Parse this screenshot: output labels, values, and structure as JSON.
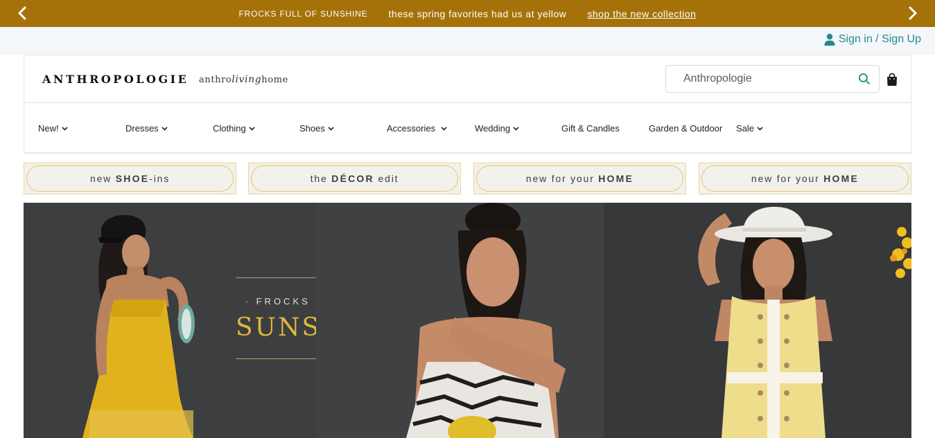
{
  "promo": {
    "eyebrow": "FROCKS FULL OF SUNSHINE",
    "message": "these spring favorites had us at yellow",
    "cta": "shop the new collection",
    "background": "#a5720a"
  },
  "account": {
    "signin_label": "Sign in / Sign Up",
    "accent": "#27898b"
  },
  "header": {
    "logo": "ANTHROPOLOGIE",
    "sub_logo_prefix": "anthro",
    "sub_logo_script": "living",
    "sub_logo_suffix": "home",
    "search_placeholder": "Anthropologie"
  },
  "nav": {
    "items": [
      {
        "label": "New!",
        "has_dropdown": true
      },
      {
        "label": "Dresses",
        "has_dropdown": true
      },
      {
        "label": "Clothing",
        "has_dropdown": true
      },
      {
        "label": "Shoes",
        "has_dropdown": true
      },
      {
        "label": "Accessories",
        "has_dropdown": true
      },
      {
        "label": "Wedding",
        "has_dropdown": true
      },
      {
        "label": "Gift & Candles",
        "has_dropdown": false
      },
      {
        "label": "Garden & Outdoor",
        "has_dropdown": false
      },
      {
        "label": "Sale",
        "has_dropdown": true
      }
    ]
  },
  "tiles": [
    {
      "pre": "new ",
      "bold": "SHOE",
      "post": "-ins"
    },
    {
      "pre": "the ",
      "bold": "DÉCOR",
      "post": " edit"
    },
    {
      "pre": "new for your ",
      "bold": "HOME",
      "post": ""
    },
    {
      "pre": "new for your ",
      "bold": "HOME",
      "post": ""
    }
  ],
  "hero": {
    "kicker": "· FROCKS FULL OF ·",
    "headline": "SUNSHINE",
    "headline_color": "#e1b740"
  },
  "icons": {
    "prev": "chevron-left-icon",
    "next": "chevron-right-icon",
    "user": "user-icon",
    "search": "search-icon",
    "bag": "shopping-bag-icon",
    "dropdown": "chevron-down-icon"
  }
}
